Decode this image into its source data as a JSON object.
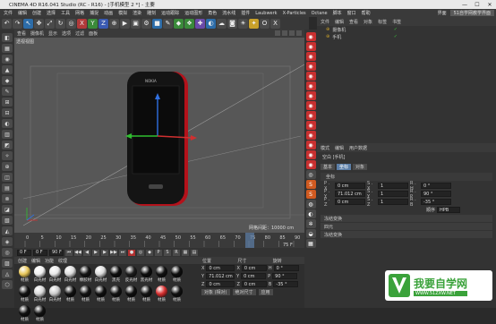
{
  "window": {
    "title": "CINEMA 4D R16.041 Studio (RC - R16) - [手机模型 2 *] - 主要",
    "min": "—",
    "max": "☐",
    "close": "✕"
  },
  "menu": {
    "items": [
      "文件",
      "编辑",
      "创建",
      "选择",
      "工具",
      "网格",
      "捕捉",
      "动画",
      "模拟",
      "渲染",
      "雕刻",
      "运动跟踪",
      "运动图形",
      "角色",
      "流水线",
      "插件",
      "Laubwerk",
      "X-Particles",
      "Octane",
      "脚本",
      "窗口",
      "帮助"
    ],
    "layout_label": "界面",
    "layout_value": "51自学网教学界面"
  },
  "toolbar": {
    "icons": [
      {
        "name": "undo-icon",
        "glyph": "↶",
        "color": "#4a4a4a"
      },
      {
        "name": "redo-icon",
        "glyph": "↷",
        "color": "#4a4a4a"
      },
      {
        "name": "live-select-icon",
        "glyph": "↖",
        "color": "#2c6ca8"
      },
      {
        "name": "move-icon",
        "glyph": "✥",
        "color": "#4a4a4a"
      },
      {
        "name": "scale-icon",
        "glyph": "⤢",
        "color": "#4a4a4a"
      },
      {
        "name": "rotate-icon",
        "glyph": "↻",
        "color": "#4a4a4a"
      },
      {
        "name": "recent-tool-icon",
        "glyph": "◎",
        "color": "#4a4a4a"
      },
      {
        "name": "x-axis-icon",
        "glyph": "X",
        "color": "#b23a3a"
      },
      {
        "name": "y-axis-icon",
        "glyph": "Y",
        "color": "#3a8a3a"
      },
      {
        "name": "z-axis-icon",
        "glyph": "Z",
        "color": "#3a5ab2"
      },
      {
        "name": "coordinate-system-icon",
        "glyph": "⊕",
        "color": "#4a4a4a"
      },
      {
        "name": "render-view-icon",
        "glyph": "▶",
        "color": "#4a4a4a"
      },
      {
        "name": "render-picture-viewer-icon",
        "glyph": "▣",
        "color": "#4a4a4a"
      },
      {
        "name": "render-settings-icon",
        "glyph": "⚙",
        "color": "#4a4a4a"
      },
      {
        "name": "cube-icon",
        "glyph": "■",
        "color": "#2c6ca8"
      },
      {
        "name": "pen-icon",
        "glyph": "✎",
        "color": "#4a4a4a"
      },
      {
        "name": "subdivision-icon",
        "glyph": "◆",
        "color": "#3a8a3a"
      },
      {
        "name": "array-icon",
        "glyph": "❖",
        "color": "#3a8a3a"
      },
      {
        "name": "cloner-icon",
        "glyph": "✚",
        "color": "#6a4aa8"
      },
      {
        "name": "deformer-icon",
        "glyph": "◐",
        "color": "#2c6ca8"
      },
      {
        "name": "environment-icon",
        "glyph": "☁",
        "color": "#4a4a4a"
      },
      {
        "name": "camera-icon",
        "glyph": "◙",
        "color": "#4a4a4a"
      },
      {
        "name": "light-icon",
        "glyph": "☀",
        "color": "#4a4a4a"
      },
      {
        "name": "tag-icon",
        "glyph": "✦",
        "color": "#c8a02a"
      },
      {
        "name": "octane-icon",
        "glyph": "O",
        "color": "#4a4a4a"
      },
      {
        "name": "xp-icon",
        "glyph": "X",
        "color": "#4a4a4a"
      }
    ]
  },
  "left_tools": [
    "◧",
    "▦",
    "◉",
    "▲",
    "◆",
    "✎",
    "⊞",
    "⊟",
    "◐",
    "▥",
    "◩",
    "✧",
    "⊕",
    "◫",
    "▤",
    "⊗",
    "◪",
    "▧",
    "◭",
    "◈",
    "◎",
    "▨",
    "◬",
    "⬡"
  ],
  "viewport": {
    "menu": [
      "查看",
      "摄像机",
      "显示",
      "选项",
      "过滤",
      "面板"
    ],
    "label": "透视视图",
    "grid_info": "网格间距：10000 cm"
  },
  "right_tools": [
    {
      "glyph": "◉",
      "color": "#c83030"
    },
    {
      "glyph": "◉",
      "color": "#c83030"
    },
    {
      "glyph": "◉",
      "color": "#c83030"
    },
    {
      "glyph": "◉",
      "color": "#c83030"
    },
    {
      "glyph": "◉",
      "color": "#c83030"
    },
    {
      "glyph": "◉",
      "color": "#c83030"
    },
    {
      "glyph": "◉",
      "color": "#c83030"
    },
    {
      "glyph": "◉",
      "color": "#c83030"
    },
    {
      "glyph": "◉",
      "color": "#c83030"
    },
    {
      "glyph": "◉",
      "color": "#c83030"
    },
    {
      "glyph": "◉",
      "color": "#c83030"
    },
    {
      "glyph": "◉",
      "color": "#c83030"
    },
    {
      "glyph": "◉",
      "color": "#c83030"
    },
    {
      "glyph": "◉",
      "color": "#c83030"
    },
    {
      "glyph": "◎",
      "color": "#4a4a4a"
    },
    {
      "glyph": "S",
      "color": "#d05a20"
    },
    {
      "glyph": "S",
      "color": "#d05a20"
    },
    {
      "glyph": "◍",
      "color": "#4a4a4a"
    },
    {
      "glyph": "◐",
      "color": "#4a4a4a"
    },
    {
      "glyph": "✲",
      "color": "#4a4a4a"
    },
    {
      "glyph": "◒",
      "color": "#4a4a4a"
    },
    {
      "glyph": "▦",
      "color": "#4a4a4a"
    }
  ],
  "objects": {
    "menu": [
      "文件",
      "编辑",
      "查看",
      "对象",
      "标签",
      "书签"
    ],
    "rows": [
      {
        "name": "摄像机",
        "checked": true
      },
      {
        "name": "手机",
        "checked": true
      }
    ]
  },
  "attributes": {
    "menu": [
      "模式",
      "编辑",
      "用户数据"
    ],
    "object_title": "空白 [手机]",
    "tabs": [
      "基本",
      "坐标",
      "对象"
    ],
    "section": "坐标",
    "rows": [
      {
        "a": "P . X",
        "av": "0 cm",
        "b": "S . X",
        "bv": "1",
        "c": "R . H",
        "cv": "0 °"
      },
      {
        "a": "P . Y",
        "av": "71.012 cm",
        "b": "S . Y",
        "bv": "1",
        "c": "R . P",
        "cv": "90 °"
      },
      {
        "a": "P . Z",
        "av": "0 cm",
        "b": "S . Z",
        "bv": "1",
        "c": "R . B",
        "cv": "-35 °"
      }
    ],
    "order_label": "顺序",
    "order_value": "HPB",
    "collapsed": [
      "冻结变换",
      "四元",
      "冻结变换"
    ]
  },
  "timeline": {
    "ticks": [
      "0",
      "5",
      "10",
      "15",
      "20",
      "25",
      "30",
      "35",
      "40",
      "45",
      "50",
      "55",
      "60",
      "65",
      "70",
      "75",
      "80",
      "85",
      "90"
    ],
    "current_frame": "75",
    "end_frame": "75 F",
    "start_field": "0 F",
    "end_field": "90 F",
    "end_field2": "90 F"
  },
  "materials": {
    "menu": [
      "创建",
      "编辑",
      "功能",
      "纹理"
    ],
    "items": [
      {
        "label": "材质",
        "color": "#e8c75a"
      },
      {
        "label": "白光材",
        "color": "#f0f0f0"
      },
      {
        "label": "白光材",
        "color": "#e8e8e8"
      },
      {
        "label": "白光材",
        "color": "#dcdcdc"
      },
      {
        "label": "橡胶材",
        "color": "#151515"
      },
      {
        "label": "白光材",
        "color": "#dcdcdc"
      },
      {
        "label": "黑壳",
        "color": "#0e0e0e"
      },
      {
        "label": "反光材",
        "color": "#1d1d1d"
      },
      {
        "label": "黑光材",
        "color": "#0d0d0d"
      },
      {
        "label": "材质",
        "color": "#111111"
      },
      {
        "label": "材质",
        "color": "#0f0f0f"
      },
      {
        "label": "材质",
        "color": "#121212"
      },
      {
        "label": "白光材",
        "color": "#d8d8d8"
      },
      {
        "label": "白光材",
        "color": "#cacaca"
      },
      {
        "label": "材质",
        "color": "#111111"
      },
      {
        "label": "材质",
        "color": "#131313"
      },
      {
        "label": "材质",
        "color": "#101010"
      },
      {
        "label": "材质",
        "color": "#121212"
      },
      {
        "label": "材质",
        "color": "#0f0f0f"
      },
      {
        "label": "材质",
        "color": "#141414"
      },
      {
        "label": "材质",
        "color": "#d83030"
      },
      {
        "label": "材质",
        "color": "#111111"
      },
      {
        "label": "材质",
        "color": "#101010"
      },
      {
        "label": "材质",
        "color": "#121212"
      }
    ]
  },
  "coords": {
    "headers": [
      "位置",
      "尺寸",
      "旋转"
    ],
    "rows": [
      {
        "axis": "X",
        "pos": "0 cm",
        "size": "0 cm",
        "rot_label": "H",
        "rot": "0 °"
      },
      {
        "axis": "Y",
        "pos": "71.012 cm",
        "size": "0 cm",
        "rot_label": "P",
        "rot": "90 °"
      },
      {
        "axis": "Z",
        "pos": "0 cm",
        "size": "0 cm",
        "rot_label": "B",
        "rot": "-35 °"
      }
    ],
    "mode1": "对象 (相对)",
    "mode2": "绝对尺寸",
    "apply": "应用"
  },
  "watermark": {
    "title": "我要自学网",
    "url": "WWW.51ZXW.NET"
  },
  "colors": {
    "phone_red": "#b3121b",
    "axis_x": "#d03030",
    "axis_y": "#30c030",
    "axis_z": "#3070e0",
    "brand_green": "#3aa23a"
  }
}
